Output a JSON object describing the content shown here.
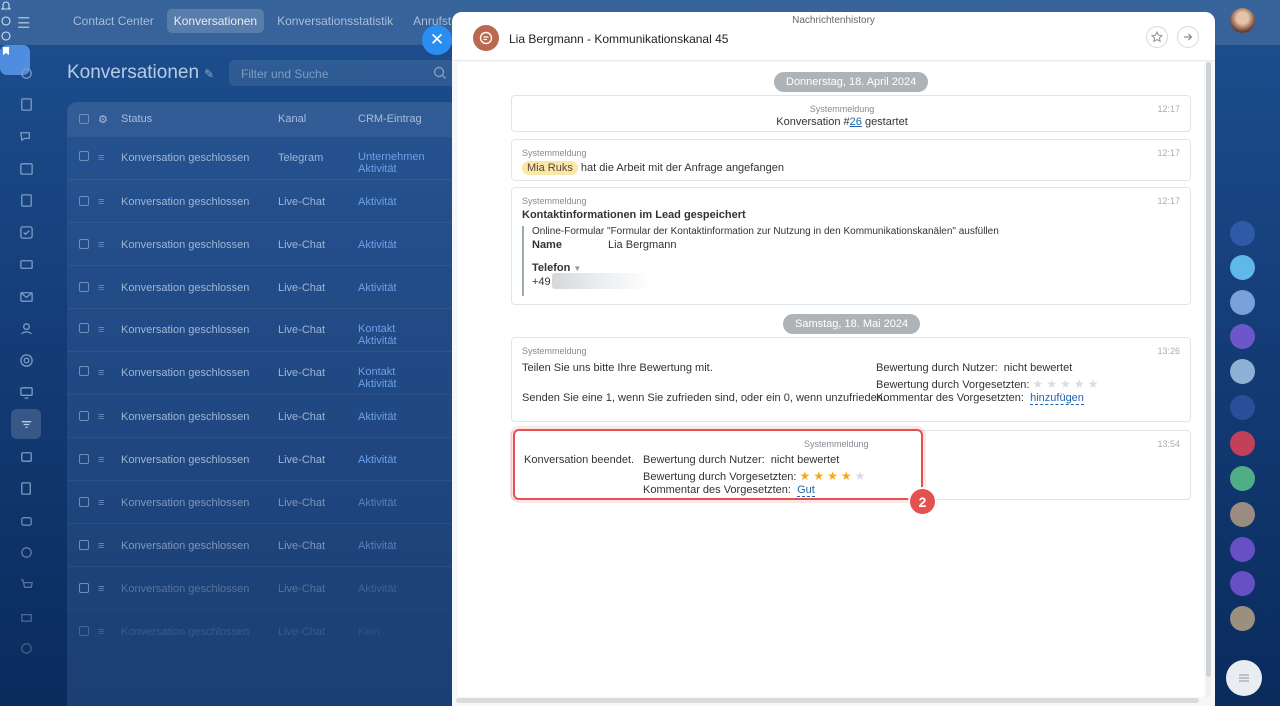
{
  "topnav": {
    "tabs": [
      "Contact Center",
      "Konversationen",
      "Konversationsstatistik",
      "Anrufstat"
    ]
  },
  "page": {
    "title": "Konversationen",
    "search_placeholder": "Filter und Suche"
  },
  "grid": {
    "columns": [
      "Status",
      "Kanal",
      "CRM-Eintrag"
    ],
    "rows": [
      {
        "status": "Konversation geschlossen",
        "channel": "Telegram",
        "crm": [
          "Unternehmen",
          "Aktivität"
        ]
      },
      {
        "status": "Konversation geschlossen",
        "channel": "Live-Chat",
        "crm": [
          "Aktivität"
        ]
      },
      {
        "status": "Konversation geschlossen",
        "channel": "Live-Chat",
        "crm": [
          "Aktivität"
        ]
      },
      {
        "status": "Konversation geschlossen",
        "channel": "Live-Chat",
        "crm": [
          "Aktivität"
        ]
      },
      {
        "status": "Konversation geschlossen",
        "channel": "Live-Chat",
        "crm": [
          "Kontakt",
          "Aktivität"
        ]
      },
      {
        "status": "Konversation geschlossen",
        "channel": "Live-Chat",
        "crm": [
          "Kontakt",
          "Aktivität"
        ]
      },
      {
        "status": "Konversation geschlossen",
        "channel": "Live-Chat",
        "crm": [
          "Aktivität"
        ]
      },
      {
        "status": "Konversation geschlossen",
        "channel": "Live-Chat",
        "crm": [
          "Aktivität"
        ]
      },
      {
        "status": "Konversation geschlossen",
        "channel": "Live-Chat",
        "crm": [
          "Aktivität"
        ]
      },
      {
        "status": "Konversation geschlossen",
        "channel": "Live-Chat",
        "crm": [
          "Aktivität"
        ]
      },
      {
        "status": "Konversation geschlossen",
        "channel": "Live-Chat",
        "crm": [
          "Aktivität"
        ]
      },
      {
        "status": "Konversation geschlossen",
        "channel": "Live-Chat",
        "crm": [
          "Kein"
        ]
      }
    ]
  },
  "slider": {
    "subtitle": "Nachrichtenhistory",
    "contact_name": "Lia Bergmann - Kommunikationskanal 45",
    "date1": "Donnerstag, 18. April 2024",
    "date2": "Samstag, 18. Mai 2024",
    "sys": "Systemmeldung",
    "msg1": {
      "time": "12:17",
      "text_pre": "Konversation #",
      "link": "26",
      "text_post": " gestartet"
    },
    "msg2": {
      "time": "12:17",
      "chip": "Mia Ruks",
      "text": "hat die Arbeit mit der Anfrage angefangen"
    },
    "msg3": {
      "time": "12:17",
      "title": "Kontaktinformationen im Lead gespeichert",
      "form_title": "Online-Formular \"Formular der Kontaktinformation zur Nutzung in den Kommunikationskanälen\" ausfüllen",
      "name_label": "Name",
      "name_value": "Lia Bergmann",
      "phone_label": "Telefon",
      "phone_value": "+49"
    },
    "msg4": {
      "time": "13:26",
      "line1": "Teilen Sie uns bitte Ihre Bewertung mit.",
      "line2": "Senden Sie eine 1, wenn Sie zufrieden sind, oder ein 0, wenn unzufrieden.",
      "user_rating_label": "Bewertung durch Nutzer:",
      "user_rating_value": "nicht bewertet",
      "sup_rating_label": "Bewertung durch Vorgesetzten:",
      "sup_rating_value": 0,
      "comment_label": "Kommentar des Vorgesetzten:",
      "comment_link": "hinzufügen"
    },
    "msg5": {
      "time": "13:54",
      "ended": "Konversation beendet.",
      "user_rating_label": "Bewertung durch Nutzer:",
      "user_rating_value": "nicht bewertet",
      "sup_rating_label": "Bewertung durch Vorgesetzten:",
      "sup_rating_value": 4,
      "comment_label": "Kommentar des Vorgesetzten:",
      "comment_link": "Gut"
    }
  },
  "annotation": {
    "badge": "2",
    "color": "#e3524f"
  }
}
